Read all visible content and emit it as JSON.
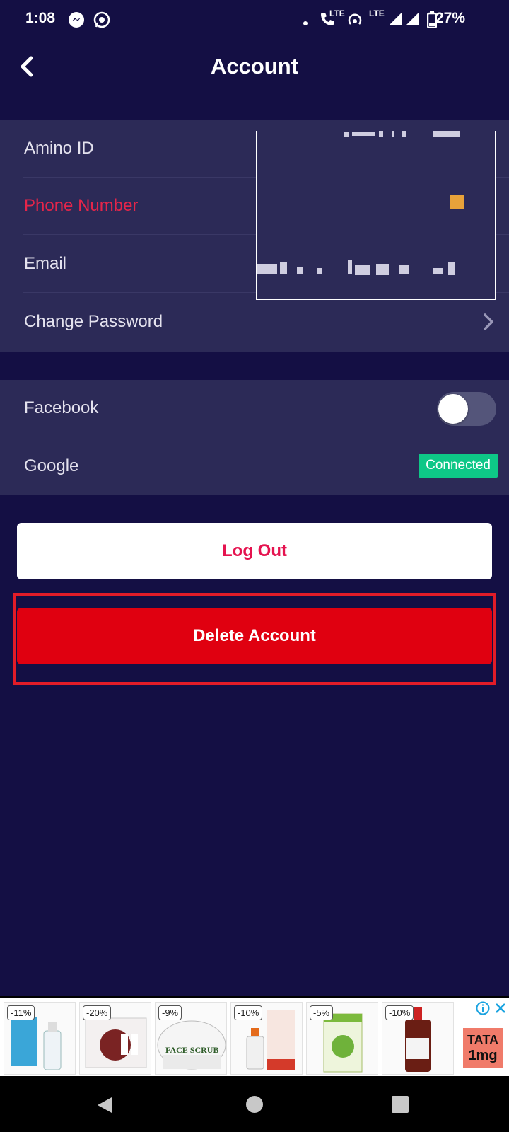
{
  "status_bar": {
    "time": "1:08",
    "battery": "27%",
    "call_lte": "LTE",
    "network": "LTE"
  },
  "header": {
    "title": "Account"
  },
  "account_section": {
    "items": [
      {
        "label": "Amino ID"
      },
      {
        "label": "Phone Number"
      },
      {
        "label": "Email"
      },
      {
        "label": "Change Password"
      }
    ]
  },
  "linked_section": {
    "facebook": {
      "label": "Facebook",
      "enabled": false
    },
    "google": {
      "label": "Google",
      "status": "Connected"
    }
  },
  "actions": {
    "logout_label": "Log Out",
    "delete_label": "Delete Account"
  },
  "ad": {
    "items": [
      {
        "discount": "-11%"
      },
      {
        "discount": "-20%"
      },
      {
        "discount": "-9%",
        "product_text": "FACE SCRUB"
      },
      {
        "discount": "-10%"
      },
      {
        "discount": "-5%"
      },
      {
        "discount": "-10%"
      }
    ],
    "brand_line1": "TATA",
    "brand_line2": "1mg"
  },
  "colors": {
    "background": "#140f44",
    "section": "#2c2a57",
    "accent_red": "#e00010",
    "connected_green": "#0ec787",
    "phone_label": "#e5254a"
  }
}
